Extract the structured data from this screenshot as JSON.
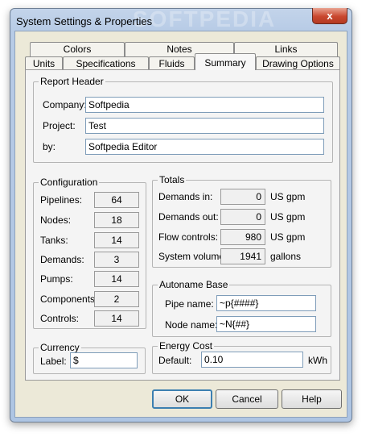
{
  "window": {
    "title": "System Settings & Properties",
    "watermark": "SOFTPEDIA",
    "close_glyph": "x"
  },
  "tabs": {
    "back_row": [
      "Colors",
      "Notes",
      "Links"
    ],
    "front_row": [
      "Units",
      "Specifications",
      "Fluids",
      "Summary",
      "Drawing Options"
    ],
    "active": "Summary"
  },
  "report_header": {
    "title": "Report Header",
    "company": {
      "label": "Company:",
      "value": "Softpedia"
    },
    "project": {
      "label": "Project:",
      "value": "Test"
    },
    "by": {
      "label": "by:",
      "value": "Softpedia Editor"
    }
  },
  "configuration": {
    "title": "Configuration",
    "items": [
      {
        "label": "Pipelines:",
        "value": "64"
      },
      {
        "label": "Nodes:",
        "value": "18"
      },
      {
        "label": "Tanks:",
        "value": "14"
      },
      {
        "label": "Demands:",
        "value": "3"
      },
      {
        "label": "Pumps:",
        "value": "14"
      },
      {
        "label": "Components:",
        "value": "2"
      },
      {
        "label": "Controls:",
        "value": "14"
      }
    ]
  },
  "totals": {
    "title": "Totals",
    "items": [
      {
        "label": "Demands in:",
        "value": "0",
        "unit": "US gpm"
      },
      {
        "label": "Demands out:",
        "value": "0",
        "unit": "US gpm"
      },
      {
        "label": "Flow controls:",
        "value": "980",
        "unit": "US gpm"
      },
      {
        "label": "System volume:",
        "value": "1941",
        "unit": "gallons"
      }
    ]
  },
  "autoname": {
    "title": "Autoname Base",
    "pipe": {
      "label": "Pipe name:",
      "value": "~p{####}"
    },
    "node": {
      "label": "Node name:",
      "value": "~N{##}"
    }
  },
  "currency": {
    "title": "Currency",
    "label": "Label:",
    "value": "$"
  },
  "energy": {
    "title": "Energy Cost",
    "label": "Default:",
    "value": "0.10",
    "unit": "kWh"
  },
  "buttons": {
    "ok": "OK",
    "cancel": "Cancel",
    "help": "Help"
  }
}
